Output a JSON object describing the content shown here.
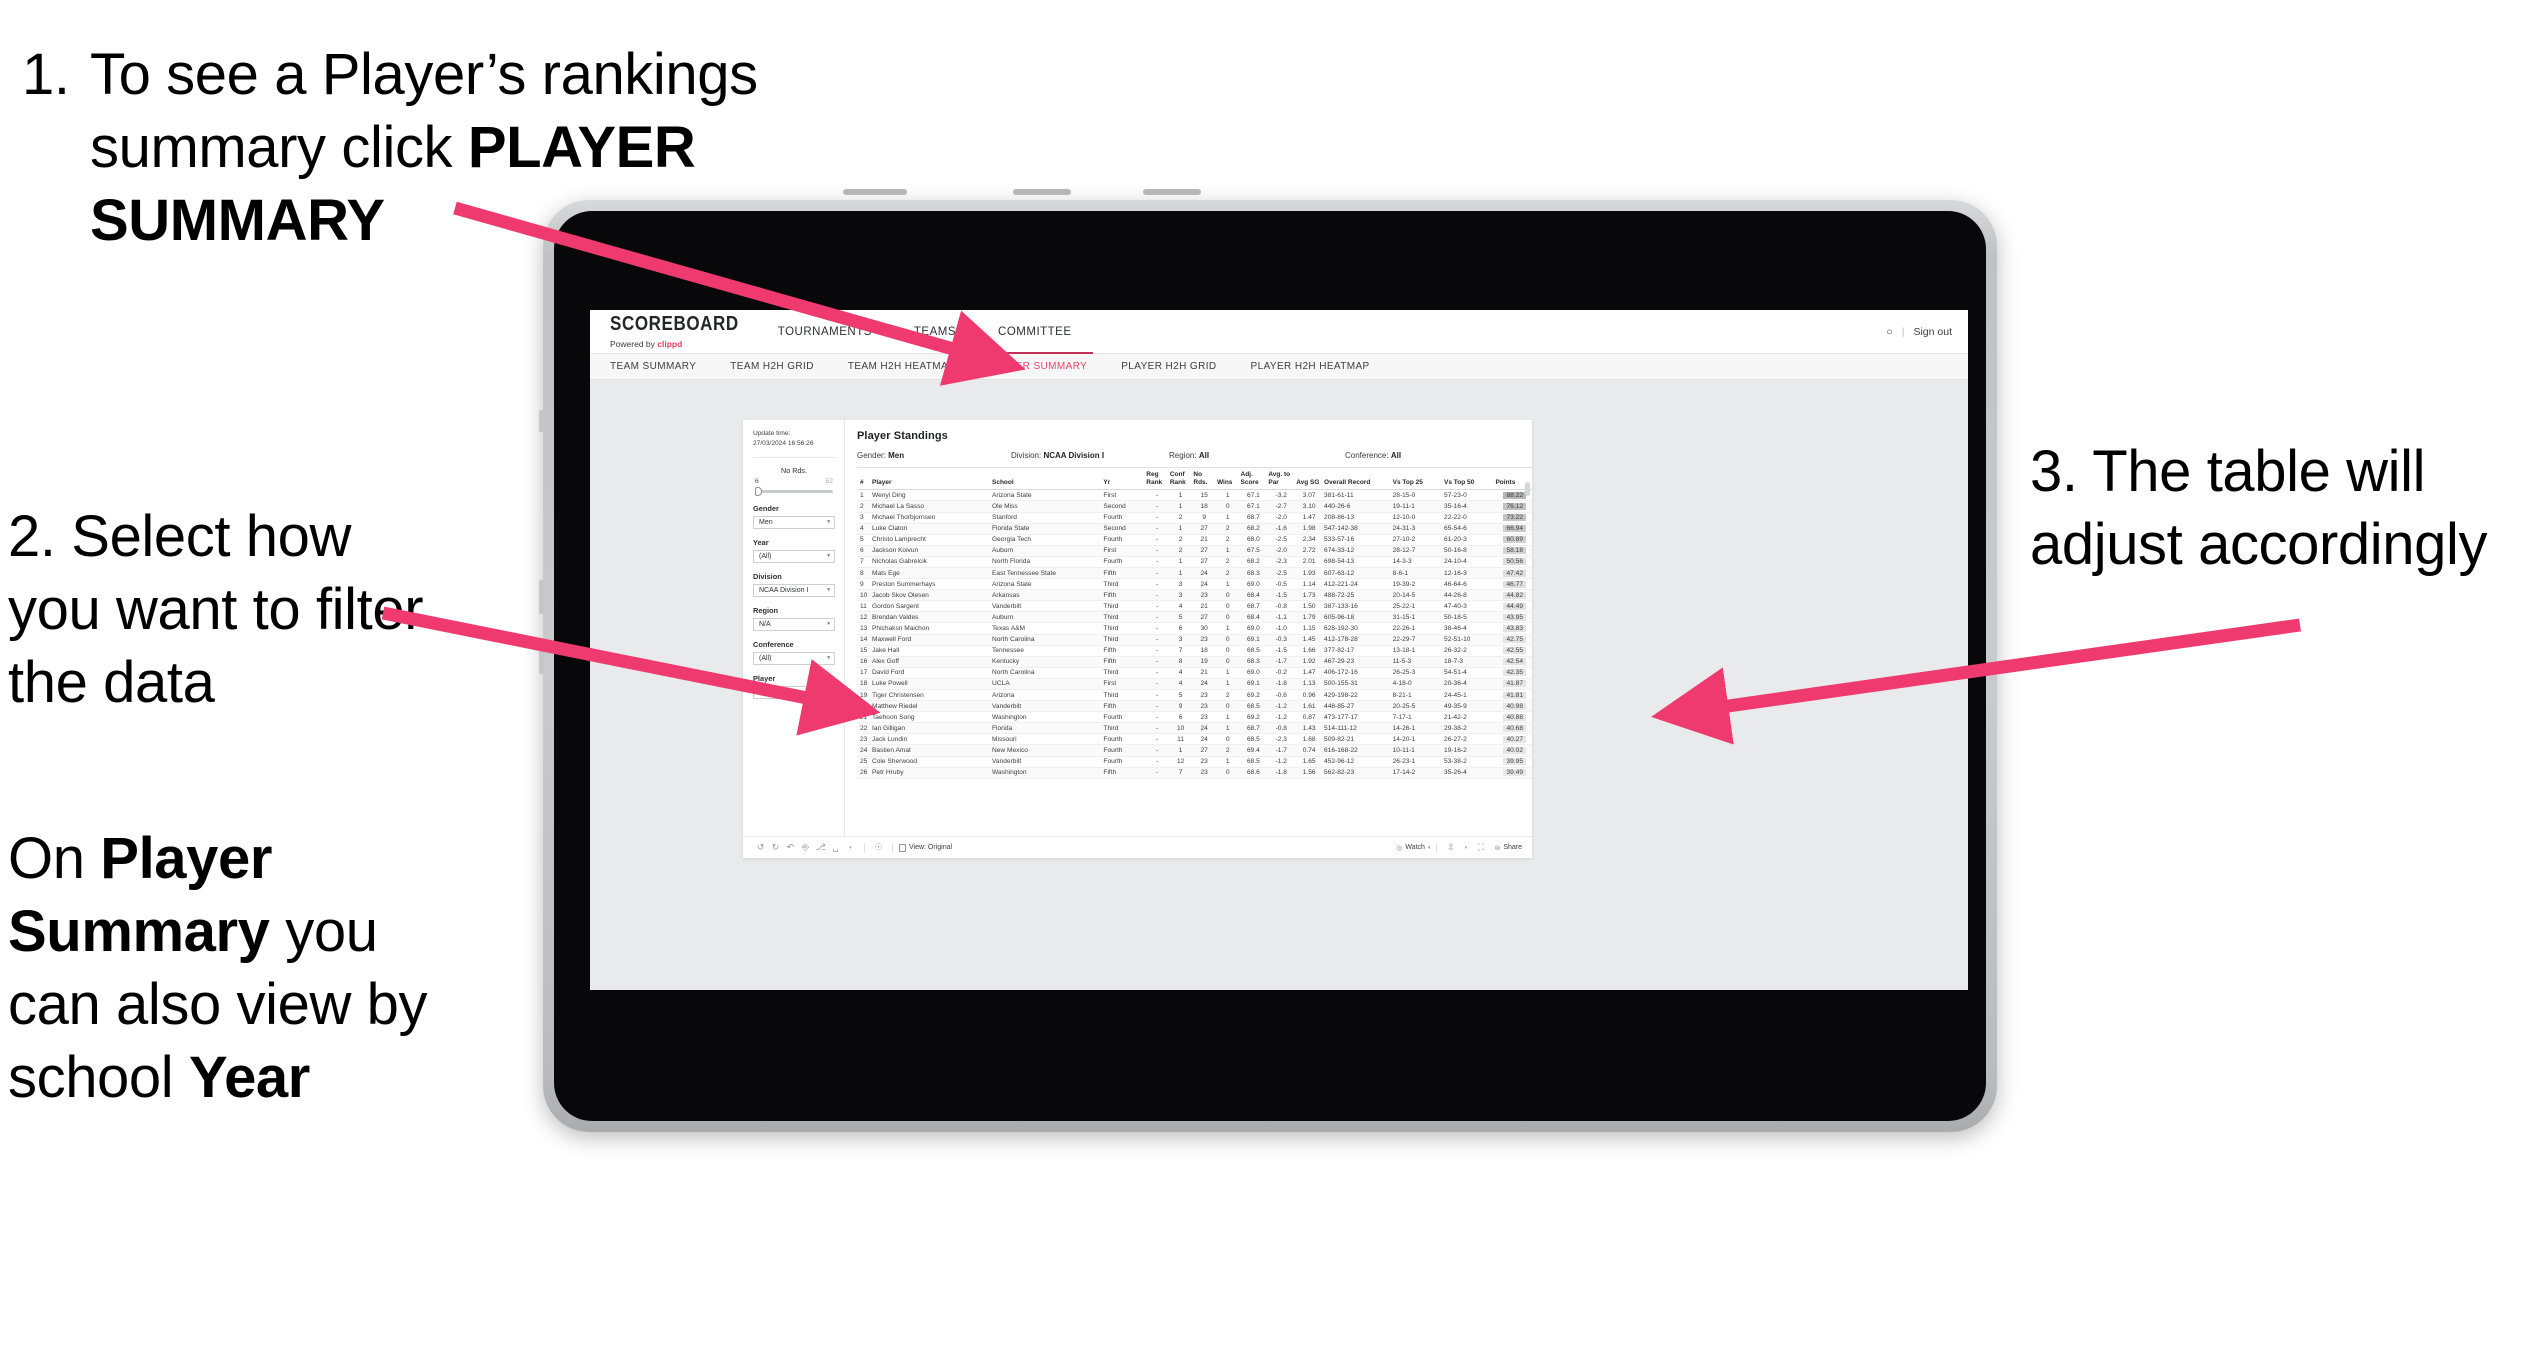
{
  "annotations": {
    "step1": {
      "number": "1.",
      "text_a": "To see a Player’s rankings summary click ",
      "text_b": "PLAYER SUMMARY"
    },
    "step2": {
      "line": "2. Select how you want to filter the data"
    },
    "step2b": {
      "pre": "On ",
      "bold1": "Player Summary",
      "mid": " you can also view by school ",
      "bold2": "Year"
    },
    "step3": {
      "line": "3. The table will adjust accordingly"
    }
  },
  "colors": {
    "accent_pink": "#ec3b62",
    "arrow_pink": "#ee3a6e",
    "tab_active": "#e8436b",
    "underline": "#c0315a"
  },
  "app": {
    "brand": {
      "name": "SCOREBOARD",
      "powered_prefix": "Powered by ",
      "powered_brand": "clippd"
    },
    "top_nav": [
      {
        "label": "TOURNAMENTS",
        "active": false
      },
      {
        "label": "TEAMS",
        "active": false
      },
      {
        "label": "COMMITTEE",
        "active": true
      }
    ],
    "top_right": {
      "user_glyph": "○",
      "divider": "|",
      "sign_out": "Sign out"
    },
    "sub_nav": [
      {
        "label": "TEAM SUMMARY",
        "active": false
      },
      {
        "label": "TEAM H2H GRID",
        "active": false
      },
      {
        "label": "TEAM H2H HEATMAP",
        "active": false
      },
      {
        "label": "PLAYER SUMMARY",
        "active": true
      },
      {
        "label": "PLAYER H2H GRID",
        "active": false
      },
      {
        "label": "PLAYER H2H HEATMAP",
        "active": false
      }
    ]
  },
  "sidebar": {
    "update_label": "Update time:",
    "update_value": "27/03/2024 16:56:26",
    "slider": {
      "title": "No Rds.",
      "min": "6",
      "max": "52"
    },
    "filters": [
      {
        "label": "Gender",
        "value": "Men"
      },
      {
        "label": "Year",
        "value": "(All)"
      },
      {
        "label": "Division",
        "value": "NCAA Division I"
      },
      {
        "label": "Region",
        "value": "N/A"
      },
      {
        "label": "Conference",
        "value": "(All)"
      },
      {
        "label": "Player",
        "value": "(All)"
      }
    ],
    "caret": "▾"
  },
  "viz": {
    "title": "Player Standings",
    "filters_line": [
      {
        "label": "Gender:",
        "value": "Men"
      },
      {
        "label": "Division:",
        "value": "NCAA Division I"
      },
      {
        "label": "Region:",
        "value": "All"
      },
      {
        "label": "Conference:",
        "value": "All"
      }
    ],
    "columns": [
      "#",
      "Player",
      "School",
      "Yr",
      "Reg Rank",
      "Conf Rank",
      "No Rds.",
      "Wins",
      "Adj. Score",
      "Avg. to Par",
      "Avg SG",
      "Overall Record",
      "Vs Top 25",
      "Vs Top 50",
      "Points"
    ],
    "rows": [
      [
        "1",
        "Wenyi Ding",
        "Arizona State",
        "First",
        "-",
        "1",
        "15",
        "1",
        "67.1",
        "-3.2",
        "3.07",
        "381-61-11",
        "28-15-0",
        "57-23-0",
        "88.22"
      ],
      [
        "2",
        "Michael La Sasso",
        "Ole Miss",
        "Second",
        "-",
        "1",
        "18",
        "0",
        "67.1",
        "-2.7",
        "3.10",
        "440-26-6",
        "19-11-1",
        "35-16-4",
        "76.12"
      ],
      [
        "3",
        "Michael Thorbjornsen",
        "Stanford",
        "Fourth",
        "-",
        "2",
        "9",
        "1",
        "68.7",
        "-2.0",
        "1.47",
        "208-86-13",
        "12-10-0",
        "22-22-0",
        "73.22"
      ],
      [
        "4",
        "Luke Claton",
        "Florida State",
        "Second",
        "-",
        "1",
        "27",
        "2",
        "68.2",
        "-1.6",
        "1.98",
        "547-142-38",
        "24-31-3",
        "65-54-6",
        "66.94"
      ],
      [
        "5",
        "Christo Lamprecht",
        "Georgia Tech",
        "Fourth",
        "-",
        "2",
        "21",
        "2",
        "68.0",
        "-2.5",
        "2.34",
        "533-57-16",
        "27-10-2",
        "61-20-3",
        "60.89"
      ],
      [
        "6",
        "Jackson Koivun",
        "Auburn",
        "First",
        "-",
        "2",
        "27",
        "1",
        "67.5",
        "-2.0",
        "2.72",
        "674-33-12",
        "28-12-7",
        "50-16-8",
        "58.18"
      ],
      [
        "7",
        "Nicholas Gabrelcik",
        "North Florida",
        "Fourth",
        "-",
        "1",
        "27",
        "2",
        "68.2",
        "-2.3",
        "2.01",
        "698-54-13",
        "14-3-3",
        "24-10-4",
        "50.56"
      ],
      [
        "8",
        "Mats Ege",
        "East Tennessee State",
        "Fifth",
        "-",
        "1",
        "24",
        "2",
        "68.3",
        "-2.5",
        "1.93",
        "607-63-12",
        "8-6-1",
        "12-16-3",
        "47.42"
      ],
      [
        "9",
        "Preston Summerhays",
        "Arizona State",
        "Third",
        "-",
        "3",
        "24",
        "1",
        "69.0",
        "-0.5",
        "1.14",
        "412-221-24",
        "19-39-2",
        "46-64-6",
        "46.77"
      ],
      [
        "10",
        "Jacob Skov Olesen",
        "Arkansas",
        "Fifth",
        "-",
        "3",
        "23",
        "0",
        "68.4",
        "-1.5",
        "1.73",
        "488-72-25",
        "20-14-5",
        "44-26-8",
        "44.82"
      ],
      [
        "11",
        "Gordon Sargent",
        "Vanderbilt",
        "Third",
        "-",
        "4",
        "21",
        "0",
        "68.7",
        "-0.8",
        "1.50",
        "387-133-16",
        "25-22-1",
        "47-40-3",
        "44.49"
      ],
      [
        "12",
        "Brendan Valdes",
        "Auburn",
        "Third",
        "-",
        "5",
        "27",
        "0",
        "68.4",
        "-1.1",
        "1.79",
        "605-96-18",
        "31-15-1",
        "50-18-5",
        "43.95"
      ],
      [
        "13",
        "Phichaksn Maichon",
        "Texas A&M",
        "Third",
        "-",
        "6",
        "30",
        "1",
        "69.0",
        "-1.0",
        "1.15",
        "628-192-30",
        "22-26-1",
        "38-46-4",
        "43.83"
      ],
      [
        "14",
        "Maxwell Ford",
        "North Carolina",
        "Third",
        "-",
        "3",
        "23",
        "0",
        "69.1",
        "-0.3",
        "1.45",
        "412-178-28",
        "22-29-7",
        "52-51-10",
        "42.75"
      ],
      [
        "15",
        "Jake Hall",
        "Tennessee",
        "Fifth",
        "-",
        "7",
        "18",
        "0",
        "68.5",
        "-1.5",
        "1.66",
        "377-82-17",
        "13-18-1",
        "26-32-2",
        "42.55"
      ],
      [
        "16",
        "Alex Goff",
        "Kentucky",
        "Fifth",
        "-",
        "8",
        "19",
        "0",
        "68.3",
        "-1.7",
        "1.92",
        "467-29-23",
        "11-5-3",
        "18-7-3",
        "42.54"
      ],
      [
        "17",
        "David Ford",
        "North Carolina",
        "Third",
        "-",
        "4",
        "21",
        "1",
        "69.0",
        "-0.2",
        "1.47",
        "406-172-16",
        "26-25-3",
        "54-51-4",
        "42.35"
      ],
      [
        "18",
        "Luke Powell",
        "UCLA",
        "First",
        "-",
        "4",
        "24",
        "1",
        "69.1",
        "-1.8",
        "1.13",
        "500-155-31",
        "4-18-0",
        "20-36-4",
        "41.87"
      ],
      [
        "19",
        "Tiger Christensen",
        "Arizona",
        "Third",
        "-",
        "5",
        "23",
        "2",
        "69.2",
        "-0.6",
        "0.96",
        "429-198-22",
        "8-21-1",
        "24-45-1",
        "41.81"
      ],
      [
        "20",
        "Matthew Riedel",
        "Vanderbilt",
        "Fifth",
        "-",
        "9",
        "23",
        "0",
        "68.5",
        "-1.2",
        "1.61",
        "448-85-27",
        "20-25-5",
        "49-35-9",
        "40.98"
      ],
      [
        "21",
        "Taehoon Song",
        "Washington",
        "Fourth",
        "-",
        "6",
        "23",
        "1",
        "69.2",
        "-1.2",
        "0.87",
        "473-177-17",
        "7-17-1",
        "21-42-2",
        "40.88"
      ],
      [
        "22",
        "Ian Gilligan",
        "Florida",
        "Third",
        "-",
        "10",
        "24",
        "1",
        "68.7",
        "-0.8",
        "1.43",
        "514-111-12",
        "14-26-1",
        "29-38-2",
        "40.68"
      ],
      [
        "23",
        "Jack Lundin",
        "Missouri",
        "Fourth",
        "-",
        "11",
        "24",
        "0",
        "68.5",
        "-2.3",
        "1.68",
        "509-82-21",
        "14-20-1",
        "26-27-2",
        "40.27"
      ],
      [
        "24",
        "Bastien Amat",
        "New Mexico",
        "Fourth",
        "-",
        "1",
        "27",
        "2",
        "69.4",
        "-1.7",
        "0.74",
        "616-168-22",
        "10-11-1",
        "19-16-2",
        "40.02"
      ],
      [
        "25",
        "Cole Sherwood",
        "Vanderbilt",
        "Fourth",
        "-",
        "12",
        "23",
        "1",
        "68.5",
        "-1.2",
        "1.65",
        "452-96-12",
        "26-23-1",
        "53-38-2",
        "39.95"
      ],
      [
        "26",
        "Petr Hruby",
        "Washington",
        "Fifth",
        "-",
        "7",
        "23",
        "0",
        "68.6",
        "-1.8",
        "1.56",
        "562-82-23",
        "17-14-2",
        "35-26-4",
        "39.49"
      ]
    ],
    "toolbar": {
      "icons": [
        "undo-icon",
        "redo-icon",
        "revert-icon",
        "refresh-icon",
        "pause-icon",
        "alert-icon",
        "dropdown-icon",
        "help-icon"
      ],
      "view_label": "View: Original",
      "watch_label": "Watch",
      "share_label": "Share"
    }
  }
}
